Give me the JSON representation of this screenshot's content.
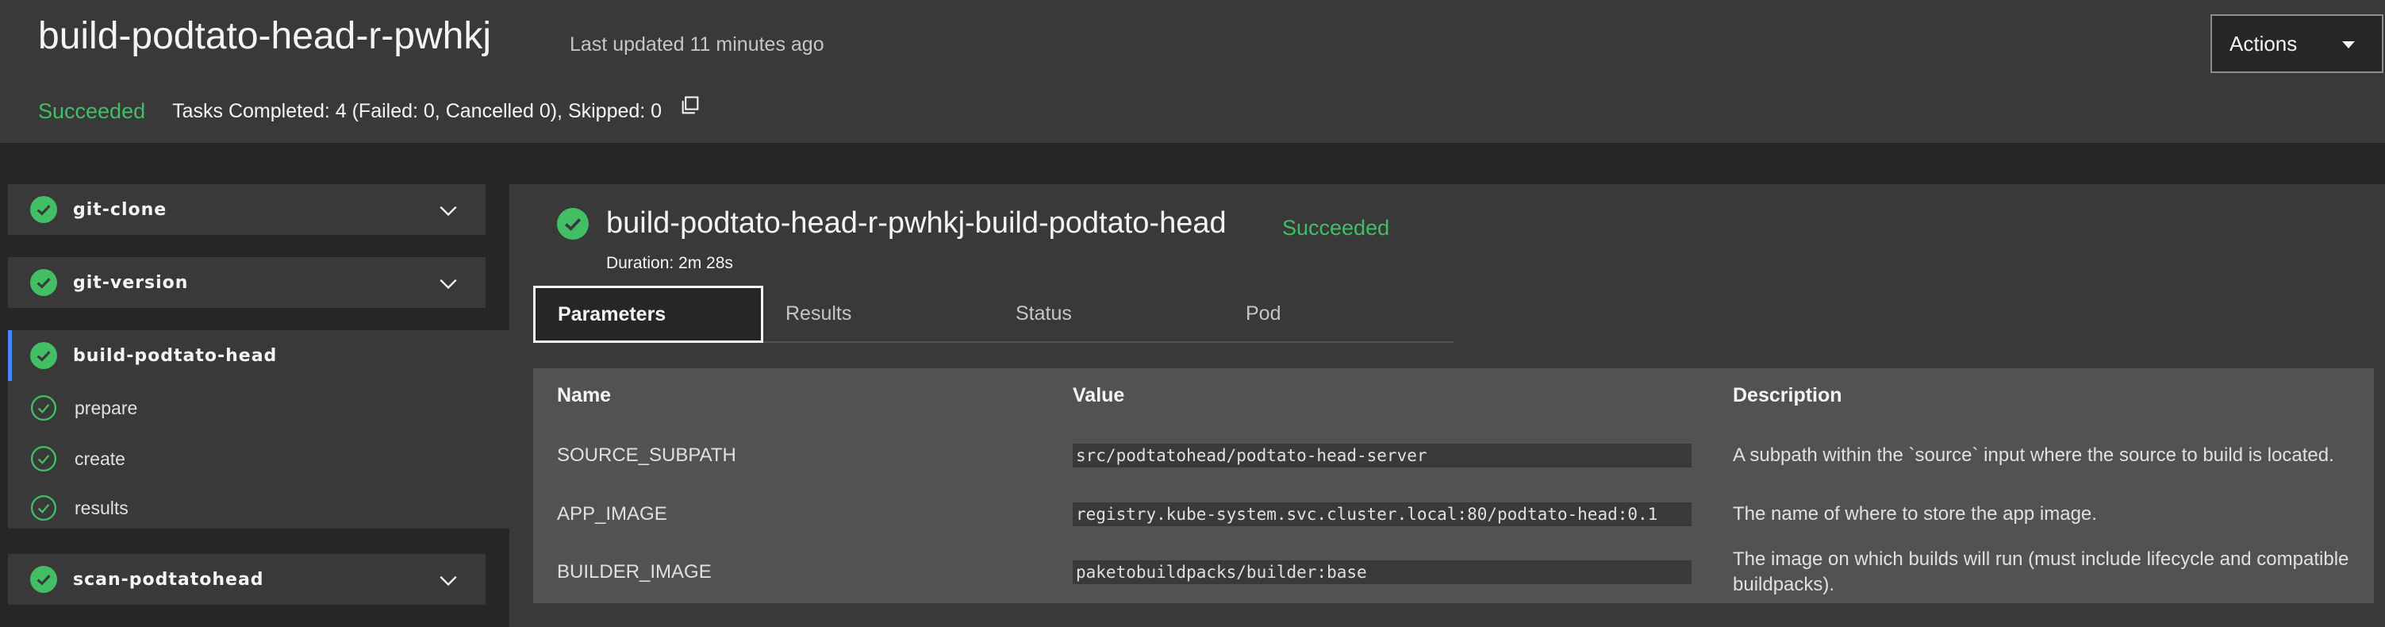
{
  "header": {
    "title": "build-podtato-head-r-pwhkj",
    "updated": "Last updated 11 minutes ago",
    "status": "Succeeded",
    "tasks_summary": "Tasks Completed: 4 (Failed: 0, Cancelled 0), Skipped: 0",
    "actions_label": "Actions"
  },
  "sidebar": {
    "tasks": [
      {
        "label": "git-clone"
      },
      {
        "label": "git-version"
      },
      {
        "label": "build-podtato-head",
        "steps": [
          {
            "label": "prepare"
          },
          {
            "label": "create"
          },
          {
            "label": "results"
          }
        ]
      },
      {
        "label": "scan-podtatohead"
      }
    ]
  },
  "main": {
    "task_title": "build-podtato-head-r-pwhkj-build-podtato-head",
    "task_status": "Succeeded",
    "duration": "Duration: 2m 28s",
    "tabs": [
      {
        "label": "Parameters"
      },
      {
        "label": "Results"
      },
      {
        "label": "Status"
      },
      {
        "label": "Pod"
      }
    ],
    "table": {
      "headers": {
        "name": "Name",
        "value": "Value",
        "description": "Description"
      },
      "rows": [
        {
          "name": "SOURCE_SUBPATH",
          "value": "src/podtatohead/podtato-head-server",
          "description": "A subpath within the `source` input where the source to build is located."
        },
        {
          "name": "APP_IMAGE",
          "value": "registry.kube-system.svc.cluster.local:80/podtato-head:0.1",
          "description": "The name of where to store the app image."
        },
        {
          "name": "BUILDER_IMAGE",
          "value": "paketobuildpacks/builder:base",
          "description": "The image on which builds will run (must include lifecycle and compatible buildpacks)."
        }
      ]
    }
  },
  "colors": {
    "success": "#42be65",
    "selected_accent": "#4589ff"
  }
}
